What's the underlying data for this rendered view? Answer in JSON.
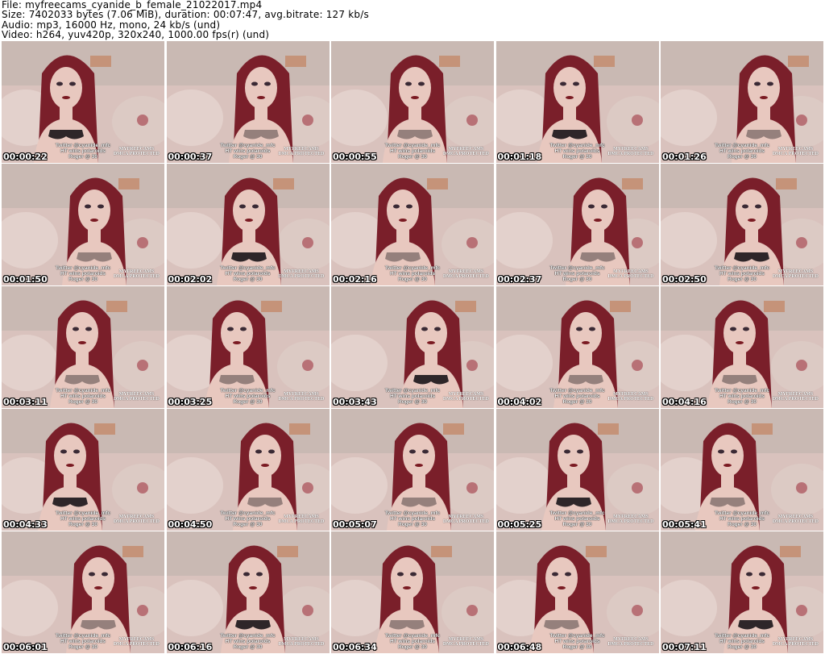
{
  "header": {
    "file": "File: myfreecams_cyanide_b_female_21022017.mp4",
    "size": "Size: 7402033 bytes (7.06 MiB), duration: 00:07:47, avg.bitrate: 127 kb/s",
    "audio": "Audio: mp3, 16000 Hz, mono, 24 kb/s (und)",
    "video": "Video: h264, yuv420p, 320x240, 1000.00 fps(r) (und)"
  },
  "overlay": {
    "line1": "Twitter @cyanide_mfc",
    "line2": "HT wins polaroids",
    "line3": "Roger @ 30",
    "wm1": "MYFREECAMS",
    "wm2": "DMCA PROTECTED"
  },
  "thumbnails": [
    "00:00:22",
    "00:00:37",
    "00:00:55",
    "00:01:18",
    "00:01:26",
    "00:01:50",
    "00:02:02",
    "00:02:16",
    "00:02:37",
    "00:02:50",
    "00:03:11",
    "00:03:25",
    "00:03:43",
    "00:04:02",
    "00:04:16",
    "00:04:33",
    "00:04:50",
    "00:05:07",
    "00:05:25",
    "00:05:41",
    "00:06:01",
    "00:06:16",
    "00:06:34",
    "00:06:48",
    "00:07:11"
  ],
  "colors": {
    "background": "#ffffff",
    "wall": "#c9b9b3",
    "pillow": "#d9c2bd",
    "hair": "#7a1f2a",
    "skin": "#e8c8bf"
  }
}
